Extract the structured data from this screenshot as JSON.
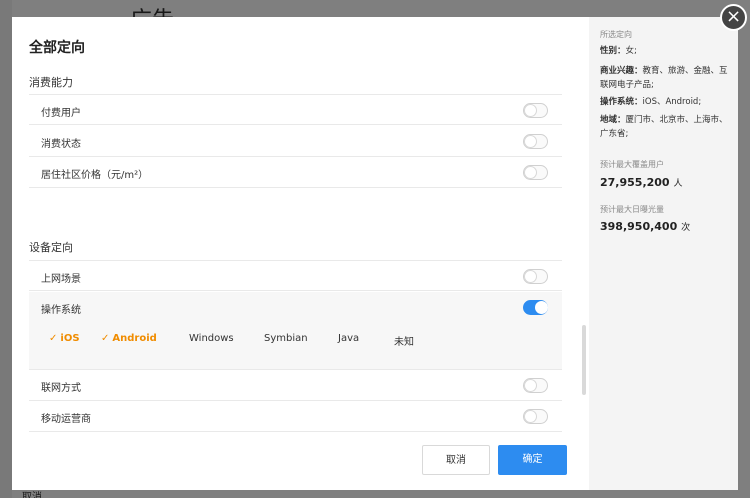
{
  "background": {
    "title": "广告",
    "bottom_text": "取消"
  },
  "modal": {
    "title": "全部定向",
    "sections": {
      "consumption": {
        "title": "消费能力",
        "rows": [
          {
            "label": "付费用户",
            "on": false
          },
          {
            "label": "消费状态",
            "on": false
          },
          {
            "label": "居住社区价格（元/m²）",
            "on": false
          }
        ]
      },
      "device": {
        "title": "设备定向",
        "row_net_scene": {
          "label": "上网场景",
          "on": false
        },
        "os": {
          "label": "操作系统",
          "on": true,
          "options": [
            {
              "label": "iOS",
              "selected": true
            },
            {
              "label": "Android",
              "selected": true
            },
            {
              "label": "Windows",
              "selected": false
            },
            {
              "label": "Symbian",
              "selected": false
            },
            {
              "label": "Java",
              "selected": false
            },
            {
              "label": "未知",
              "selected": false
            }
          ]
        },
        "rows_after": [
          {
            "label": "联网方式",
            "on": false
          },
          {
            "label": "移动运营商",
            "on": false
          }
        ]
      }
    },
    "buttons": {
      "cancel": "取消",
      "ok": "确定"
    }
  },
  "summary": {
    "heading": "所选定向",
    "items": [
      {
        "key": "性别：",
        "value": "女;"
      },
      {
        "key": "商业兴趣：",
        "value": "教育、旅游、金融、互联网电子产品;"
      },
      {
        "key": "操作系统：",
        "value": "iOS、Android;"
      },
      {
        "key": "地域：",
        "value": "厦门市、北京市、上海市、广东省;"
      }
    ],
    "reach_label": "预计最大覆盖用户",
    "reach_value": "27,955,200",
    "reach_unit": "人",
    "exposure_label": "预计最大日曝光量",
    "exposure_value": "398,950,400",
    "exposure_unit": "次"
  },
  "colors": {
    "accent": "#2d8cf0",
    "selected": "#f08c00"
  },
  "icons": {
    "close": "close-icon",
    "check": "check-icon"
  }
}
